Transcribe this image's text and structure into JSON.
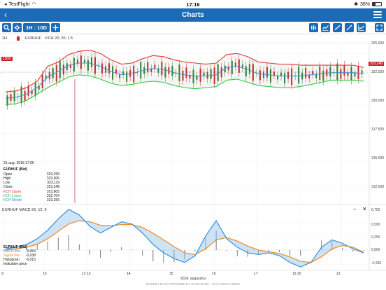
{
  "status": {
    "carrier": "TestFlight",
    "time": "17:16",
    "battery": "36%"
  },
  "nav": {
    "back": "‹",
    "title": "Charts"
  },
  "toolbar": {
    "timeframe": "1H : 10D"
  },
  "legend": {
    "period": "1H",
    "instrument": "EURHUF",
    "indicator": "KCH 20; 20; 1.5"
  },
  "price_axis": {
    "ticks": [
      "325,000",
      "322,500",
      "320,000",
      "317,500",
      "315,000",
      "312,500"
    ],
    "current_price": "323,248",
    "order_label": "150K"
  },
  "tooltip": {
    "date": "21-aug.-2018 17:00",
    "instrument": "EURHUF (Bid)",
    "rows": [
      {
        "label": "Open",
        "value": "323,299",
        "color": "#111"
      },
      {
        "label": "High",
        "value": "323,306",
        "color": "#111"
      },
      {
        "label": "Low",
        "value": "323,119",
        "color": "#111"
      },
      {
        "label": "Close",
        "value": "323,248",
        "color": "#111"
      },
      {
        "label": "KCH Upper",
        "value": "323,805",
        "color": "#e53935"
      },
      {
        "label": "KCH Lower",
        "value": "322,704",
        "color": "#2ecc40"
      },
      {
        "label": "KCH Middle",
        "value": "323,255",
        "color": "#3b8fd4"
      }
    ]
  },
  "macd": {
    "header": "EURHUF  MACD 26; 12; 9",
    "ticks": [
      "0,750",
      "0,500",
      "0,250",
      "0,000",
      "-0,250"
    ],
    "instrument": "EURHUF (Bid)",
    "rows": [
      {
        "label": "MACD line",
        "value": "-0,053",
        "color": "#3b8fd4"
      },
      {
        "label": "Signal line",
        "value": "-0,038",
        "color": "#f08a24"
      },
      {
        "label": "Histogram",
        "value": "-0,015",
        "color": "#111"
      }
    ],
    "note": "Indicative price",
    "minus": "–",
    "close": "✕"
  },
  "x_axis": {
    "labels": [
      "9",
      "10",
      "12 13",
      "14",
      "15",
      "16",
      "17",
      "19 20",
      "21"
    ],
    "month": "2018. augusztus"
  },
  "footer": "MARKET DATA PROVIDED BY SAXO BANK  ·  DATA DISCLAIMER",
  "colors": {
    "accent": "#1b6bb8",
    "upper": "#e53935",
    "lower": "#2ecc40",
    "middle": "#3b8fd4",
    "signal": "#f08a24",
    "up": "#2e7d32",
    "down": "#c62828"
  },
  "chart_data": [
    {
      "type": "line",
      "title": "",
      "series": [
        {
          "name": "KCH Upper",
          "values": [
            321.4,
            321.5,
            321.8,
            322.4,
            323.8,
            324.2,
            324.9,
            325.2,
            325.3,
            325.0,
            324.4,
            324.0,
            324.1,
            324.5,
            324.8,
            324.7,
            324.4,
            324.2,
            324.1,
            324.0,
            324.1,
            324.9,
            325.0,
            324.7,
            324.2,
            324.1,
            324.0,
            324.0,
            323.9,
            323.9,
            323.9,
            323.9,
            323.9,
            323.9,
            323.7
          ]
        },
        {
          "name": "KCH Middle",
          "values": [
            320.8,
            320.9,
            321.2,
            321.8,
            322.8,
            323.3,
            323.9,
            324.1,
            324.1,
            323.8,
            323.3,
            323.0,
            323.1,
            323.4,
            323.6,
            323.5,
            323.2,
            323.0,
            322.9,
            322.9,
            323.0,
            323.7,
            323.8,
            323.5,
            323.1,
            323.0,
            322.9,
            322.9,
            322.9,
            323.0,
            323.1,
            323.2,
            323.2,
            323.2,
            323.1
          ]
        },
        {
          "name": "KCH Lower",
          "values": [
            320.2,
            320.3,
            320.6,
            321.2,
            321.8,
            322.3,
            322.8,
            323.0,
            322.9,
            322.6,
            322.2,
            322.0,
            322.1,
            322.3,
            322.4,
            322.3,
            322.0,
            321.8,
            321.7,
            321.8,
            321.9,
            322.5,
            322.6,
            322.3,
            322.0,
            321.9,
            321.8,
            321.8,
            321.9,
            322.1,
            322.3,
            322.5,
            322.5,
            322.5,
            322.4
          ]
        }
      ],
      "ylim": [
        311.0,
        326.0
      ]
    },
    {
      "type": "line",
      "title": "",
      "series": [
        {
          "name": "MACD line",
          "values": [
            0.02,
            0.05,
            0.1,
            0.2,
            0.35,
            0.55,
            0.72,
            0.62,
            0.42,
            0.3,
            0.4,
            0.5,
            0.46,
            0.3,
            0.1,
            -0.05,
            -0.15,
            -0.22,
            -0.1,
            0.25,
            0.52,
            0.2,
            0.05,
            -0.05,
            -0.08,
            -0.05,
            -0.1,
            -0.22,
            -0.3,
            -0.22,
            0.05,
            0.18,
            0.12,
            0.02,
            -0.05
          ]
        },
        {
          "name": "Signal line",
          "values": [
            0.0,
            0.02,
            0.05,
            0.1,
            0.2,
            0.33,
            0.46,
            0.52,
            0.5,
            0.44,
            0.43,
            0.45,
            0.45,
            0.4,
            0.3,
            0.18,
            0.06,
            -0.05,
            -0.08,
            0.02,
            0.18,
            0.22,
            0.16,
            0.07,
            0.0,
            -0.03,
            -0.06,
            -0.12,
            -0.2,
            -0.22,
            -0.12,
            0.02,
            0.08,
            0.05,
            -0.04
          ]
        },
        {
          "name": "Histogram",
          "values": [
            0.02,
            0.03,
            0.05,
            0.1,
            0.15,
            0.22,
            0.26,
            0.1,
            -0.08,
            -0.14,
            -0.03,
            0.05,
            0.01,
            -0.1,
            -0.2,
            -0.23,
            -0.21,
            -0.17,
            -0.02,
            0.23,
            0.34,
            -0.02,
            -0.11,
            -0.12,
            -0.08,
            -0.02,
            -0.04,
            -0.1,
            -0.1,
            0.0,
            0.17,
            0.16,
            0.04,
            -0.03,
            -0.01
          ]
        }
      ],
      "ylim": [
        -0.36,
        0.78
      ]
    }
  ]
}
